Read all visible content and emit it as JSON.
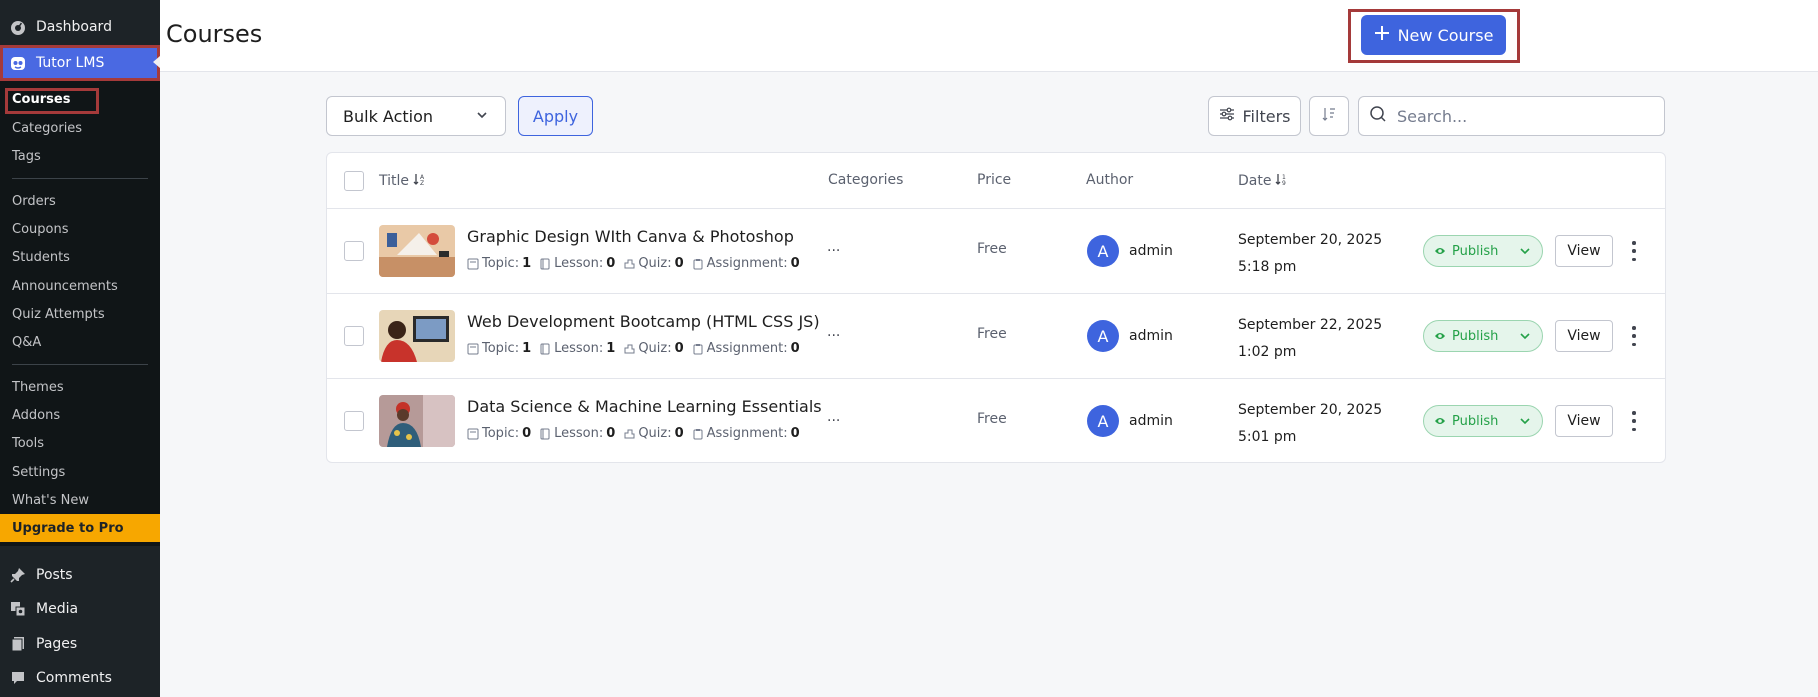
{
  "sidebar": {
    "dashboard": "Dashboard",
    "tutor_lms": "Tutor LMS",
    "submenu": [
      "Courses",
      "Categories",
      "Tags",
      "Orders",
      "Coupons",
      "Students",
      "Announcements",
      "Quiz Attempts",
      "Q&A",
      "Themes",
      "Addons",
      "Tools",
      "Settings",
      "What's New"
    ],
    "upgrade": "Upgrade to Pro",
    "bottom": [
      "Posts",
      "Media",
      "Pages",
      "Comments"
    ]
  },
  "header": {
    "title": "Courses",
    "new_course": "New Course"
  },
  "toolbar": {
    "bulk_action": "Bulk Action",
    "apply": "Apply",
    "filters": "Filters",
    "search_placeholder": "Search..."
  },
  "table": {
    "columns": {
      "title": "Title",
      "categories": "Categories",
      "price": "Price",
      "author": "Author",
      "date": "Date"
    },
    "meta_labels": {
      "topic": "Topic:",
      "lesson": "Lesson:",
      "quiz": "Quiz:",
      "assignment": "Assignment:"
    },
    "rows": [
      {
        "title": "Graphic Design WIth Canva & Photoshop",
        "topic": "1",
        "lesson": "0",
        "quiz": "0",
        "assignment": "0",
        "categories": "...",
        "price": "Free",
        "avatar": "A",
        "author": "admin",
        "date": "September 20, 2025",
        "time": "5:18 pm",
        "status": "Publish",
        "view": "View"
      },
      {
        "title": "Web Development Bootcamp (HTML CSS JS)",
        "topic": "1",
        "lesson": "1",
        "quiz": "0",
        "assignment": "0",
        "categories": "...",
        "price": "Free",
        "avatar": "A",
        "author": "admin",
        "date": "September 22, 2025",
        "time": "1:02 pm",
        "status": "Publish",
        "view": "View"
      },
      {
        "title": "Data Science & Machine Learning Essentials",
        "topic": "0",
        "lesson": "0",
        "quiz": "0",
        "assignment": "0",
        "categories": "...",
        "price": "Free",
        "avatar": "A",
        "author": "admin",
        "date": "September 20, 2025",
        "time": "5:01 pm",
        "status": "Publish",
        "view": "View"
      }
    ]
  },
  "colors": {
    "accent": "#3e64de",
    "sidebar": "#1d2327",
    "upgrade": "#f7a700",
    "publish": "#24a148",
    "highlight": "#a53a3a"
  }
}
